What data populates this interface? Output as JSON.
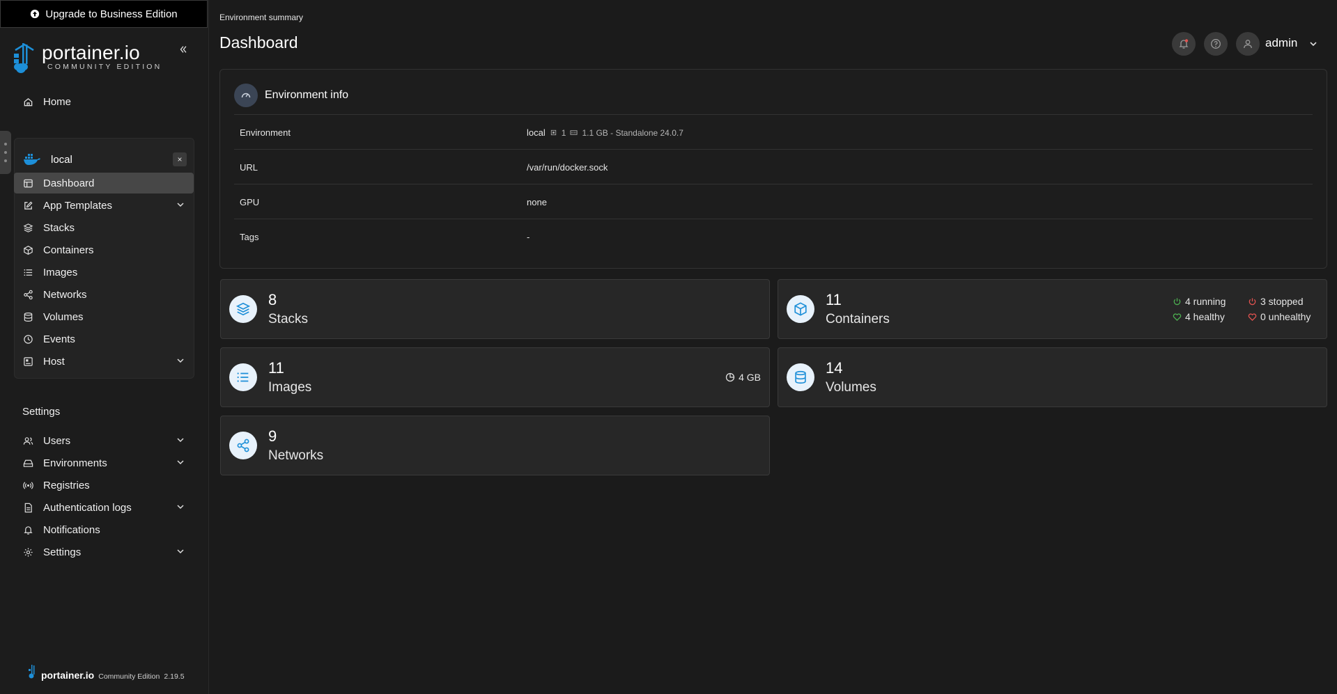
{
  "upgrade": {
    "label": "Upgrade to Business Edition"
  },
  "brand": {
    "name": "portainer.io",
    "edition": "COMMUNITY EDITION"
  },
  "nav": {
    "home": "Home"
  },
  "environment": {
    "name": "local",
    "close": "×",
    "items": [
      {
        "label": "Dashboard",
        "icon": "dashboard-icon"
      },
      {
        "label": "App Templates",
        "icon": "edit-icon"
      },
      {
        "label": "Stacks",
        "icon": "layers-icon"
      },
      {
        "label": "Containers",
        "icon": "box-icon"
      },
      {
        "label": "Images",
        "icon": "list-icon"
      },
      {
        "label": "Networks",
        "icon": "share-icon"
      },
      {
        "label": "Volumes",
        "icon": "database-icon"
      },
      {
        "label": "Events",
        "icon": "clock-icon"
      },
      {
        "label": "Host",
        "icon": "host-icon"
      }
    ]
  },
  "settings": {
    "heading": "Settings",
    "items": [
      {
        "label": "Users"
      },
      {
        "label": "Environments"
      },
      {
        "label": "Registries"
      },
      {
        "label": "Authentication logs"
      },
      {
        "label": "Notifications"
      },
      {
        "label": "Settings"
      }
    ]
  },
  "footer": {
    "name": "portainer.io",
    "edition": "Community Edition",
    "version": "2.19.5"
  },
  "header": {
    "breadcrumb": "Environment summary",
    "title": "Dashboard",
    "user": "admin"
  },
  "env_info": {
    "title": "Environment info",
    "rows": [
      {
        "key": "Environment",
        "value": "local",
        "cpu": "1",
        "memory": "1.1 GB - Standalone 24.0.7"
      },
      {
        "key": "URL",
        "value": "/var/run/docker.sock"
      },
      {
        "key": "GPU",
        "value": "none"
      },
      {
        "key": "Tags",
        "value": "-"
      }
    ]
  },
  "stats": {
    "stacks": {
      "count": "8",
      "label": "Stacks"
    },
    "containers": {
      "count": "11",
      "label": "Containers",
      "running": "4 running",
      "stopped": "3 stopped",
      "healthy": "4 healthy",
      "unhealthy": "0 unhealthy"
    },
    "images": {
      "count": "11",
      "label": "Images",
      "size": "4 GB"
    },
    "volumes": {
      "count": "14",
      "label": "Volumes"
    },
    "networks": {
      "count": "9",
      "label": "Networks"
    }
  },
  "colors": {
    "accent": "#1d8fd8",
    "running": "#4caf50",
    "stopped": "#e0524f",
    "icon_bg": "#e8f2fb"
  }
}
